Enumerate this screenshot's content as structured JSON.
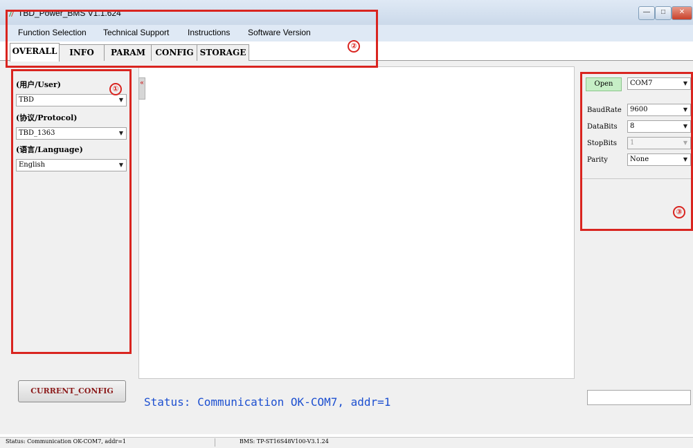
{
  "window": {
    "title": "TBD_Power_BMS V1.1.624",
    "controls": [
      "—",
      "□",
      "✕"
    ]
  },
  "menu": {
    "items": [
      "Function Selection",
      "Technical Support",
      "Instructions",
      "Software Version"
    ]
  },
  "tabs": [
    {
      "label": "OVERALL",
      "active": true
    },
    {
      "label": "INFO",
      "active": false
    },
    {
      "label": "PARAM",
      "active": false
    },
    {
      "label": "CONFIG",
      "active": false
    },
    {
      "label": "STORAGE",
      "active": false
    }
  ],
  "left_panel": {
    "user_label": "(用户/User)",
    "user_value": "TBD",
    "protocol_label": "(协议/Protocol)",
    "protocol_value": "TBD_1363",
    "language_label": "(语言/Language)",
    "language_value": "English",
    "current_config_button": "CURRENT_CONFIG"
  },
  "serial": {
    "open_button": "Open",
    "port": "COM7",
    "baudrate_label": "BaudRate",
    "baudrate": "9600",
    "databits_label": "DataBits",
    "databits": "8",
    "stopbits_label": "StopBits",
    "stopbits": "1",
    "parity_label": "Parity",
    "parity": "None"
  },
  "status_message": "Status: Communication OK-COM7, addr=1",
  "statusbar": {
    "left": "Status: Communication OK-COM7, addr=1",
    "right": "BMS: TP-ST16S48V100-V3.1.24"
  },
  "annotations": [
    "①",
    "②",
    "③"
  ],
  "colors": {
    "annotation": "#d9241f",
    "status_text": "#1c4fd0",
    "open_button_bg": "#c6efc6",
    "current_config_text": "#8b1a1a"
  }
}
